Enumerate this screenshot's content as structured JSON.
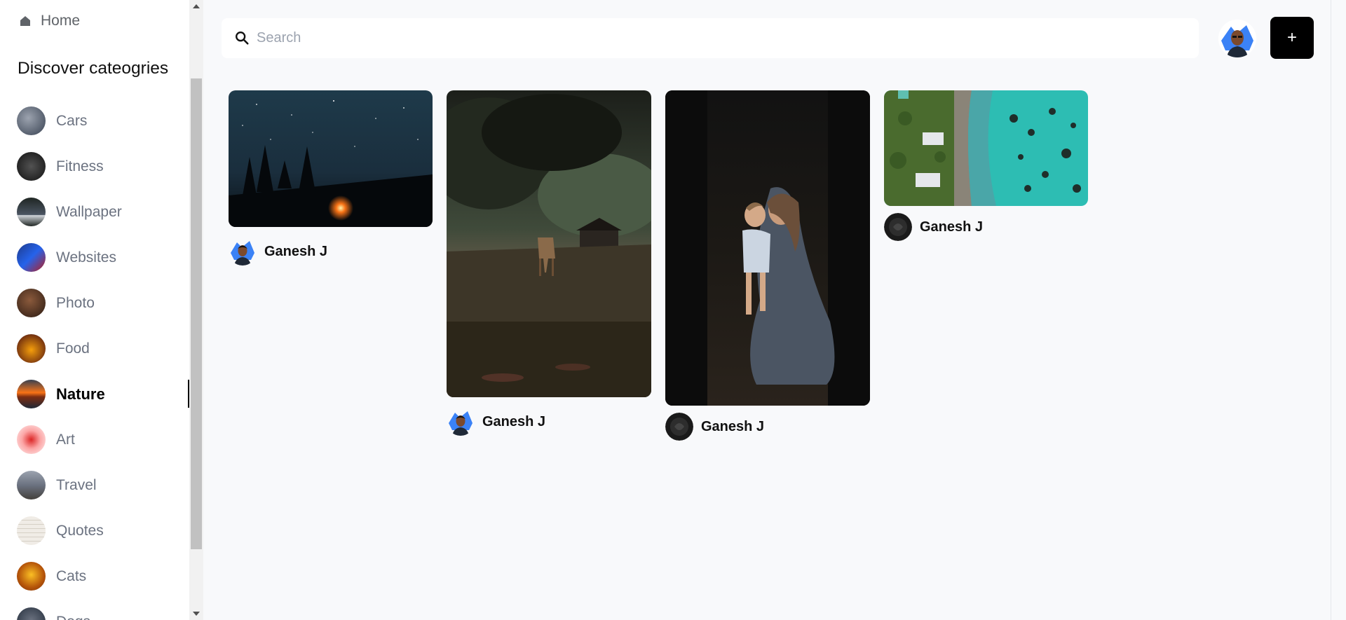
{
  "sidebar": {
    "home_label": "Home",
    "section_title": "Discover cateogries",
    "categories": [
      {
        "label": "Cars",
        "color": "#4b5563"
      },
      {
        "label": "Fitness",
        "color": "#1f1f1f"
      },
      {
        "label": "Wallpaper",
        "color": "#2d3530"
      },
      {
        "label": "Websites",
        "color": "#1e3a8a"
      },
      {
        "label": "Photo",
        "color": "#5b3a2a"
      },
      {
        "label": "Food",
        "color": "#b45309"
      },
      {
        "label": "Nature",
        "color": "#c2410c"
      },
      {
        "label": "Art",
        "color": "#f3d6d0"
      },
      {
        "label": "Travel",
        "color": "#6b7280"
      },
      {
        "label": "Quotes",
        "color": "#eeeae4"
      },
      {
        "label": "Cats",
        "color": "#d97706"
      },
      {
        "label": "Dogs",
        "color": "#374151"
      }
    ],
    "active_category": "Nature"
  },
  "search": {
    "placeholder": "Search",
    "value": ""
  },
  "header": {
    "add_label": "+"
  },
  "pins": [
    {
      "author": "Ganesh J",
      "image": "night-sky-campfire"
    },
    {
      "author": "Ganesh J",
      "image": "deer-in-forest"
    },
    {
      "author": "Ganesh J",
      "image": "mother-and-child"
    },
    {
      "author": "Ganesh J",
      "image": "aerial-coastline"
    }
  ],
  "colors": {
    "background": "#f8f9fb",
    "accent": "#000000",
    "avatar_blue": "#3b82f6"
  }
}
